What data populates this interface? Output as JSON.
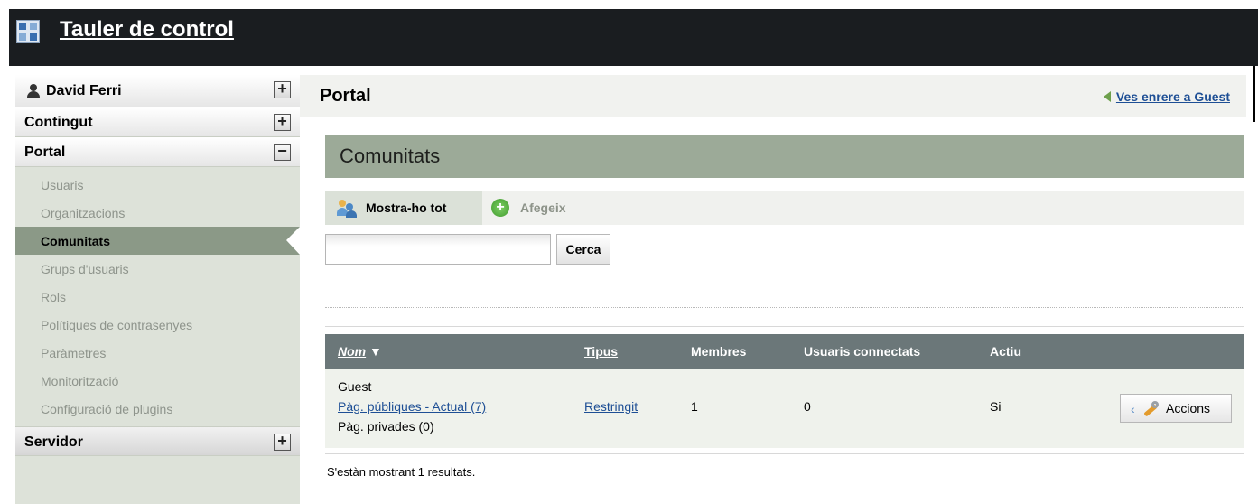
{
  "header": {
    "title": "Tauler de control",
    "logo_icon": "liferay-logo-icon"
  },
  "sidebar": {
    "user": {
      "name": "David Ferri",
      "toggle": "+"
    },
    "sections": [
      {
        "label": "Contingut",
        "toggle": "+"
      },
      {
        "label": "Portal",
        "toggle": "−",
        "items": [
          "Usuaris",
          "Organitzacions",
          "Comunitats",
          "Grups d'usuaris",
          "Rols",
          "Polítiques de contrasenyes",
          "Paràmetres",
          "Monitorització",
          "Configuració de plugins"
        ],
        "active": "Comunitats"
      },
      {
        "label": "Servidor",
        "toggle": "+"
      }
    ]
  },
  "main": {
    "title": "Portal",
    "back_link": "Ves enrere a Guest",
    "panel_title": "Comunitats",
    "tabs": {
      "show_all": "Mostra-ho tot",
      "add": "Afegeix"
    },
    "search": {
      "value": "",
      "button": "Cerca"
    },
    "table": {
      "columns": {
        "name": "Nom",
        "sort_arrow": "▼",
        "type": "Tipus",
        "members": "Membres",
        "online": "Usuaris connectats",
        "active": "Actiu"
      },
      "rows": [
        {
          "name": "Guest",
          "public_pages": "Pàg. públiques - Actual (7)",
          "private_pages": "Pàg. privades (0)",
          "type": "Restringit",
          "members": "1",
          "online": "0",
          "active": "Si",
          "action": "Accions"
        }
      ]
    },
    "results_text": "S'estàn mostrant 1 resultats."
  },
  "colors": {
    "topbar": "#1a1d20",
    "sidebar_bg": "#dde2d9",
    "active_item": "#8b9987",
    "panel_header": "#9caa98",
    "table_header": "#6b7779",
    "link": "#1e4f95"
  }
}
